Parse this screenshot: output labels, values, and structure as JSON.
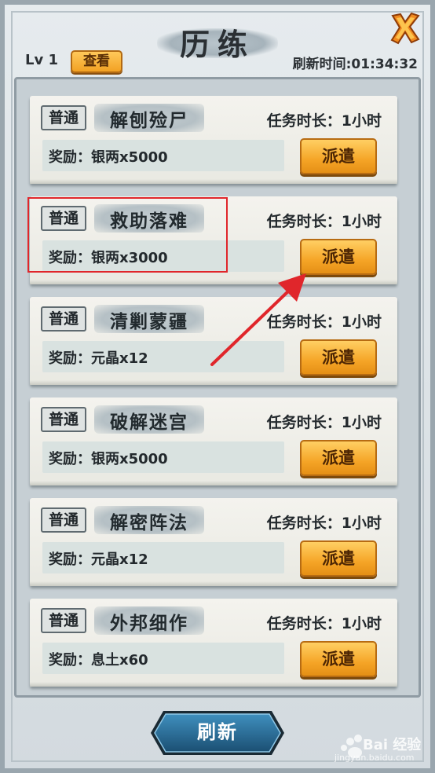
{
  "header": {
    "title": "历练",
    "level": "Lv 1",
    "view_label": "查看",
    "refresh_time": "刷新时间:01:34:32"
  },
  "tasks": [
    {
      "type": "普通",
      "name": "解刨殓尸",
      "duration": "任务时长：1小时",
      "reward": "奖励：银两x5000",
      "dispatch": "派遣"
    },
    {
      "type": "普通",
      "name": "救助落难",
      "duration": "任务时长：1小时",
      "reward": "奖励：银两x3000",
      "dispatch": "派遣"
    },
    {
      "type": "普通",
      "name": "清剿蒙疆",
      "duration": "任务时长：1小时",
      "reward": "奖励：元晶x12",
      "dispatch": "派遣"
    },
    {
      "type": "普通",
      "name": "破解迷宫",
      "duration": "任务时长：1小时",
      "reward": "奖励：银两x5000",
      "dispatch": "派遣"
    },
    {
      "type": "普通",
      "name": "解密阵法",
      "duration": "任务时长：1小时",
      "reward": "奖励：元晶x12",
      "dispatch": "派遣"
    },
    {
      "type": "普通",
      "name": "外邦细作",
      "duration": "任务时长：1小时",
      "reward": "奖励：息土x60",
      "dispatch": "派遣"
    }
  ],
  "footer": {
    "refresh_label": "刷新"
  },
  "watermark": {
    "text": "Bai 经验",
    "sub": "jingyan.baidu.com"
  },
  "colors": {
    "accent_orange": "#f5a527",
    "highlight_red": "#e0262b",
    "refresh_blue": "#2a6f9a"
  }
}
